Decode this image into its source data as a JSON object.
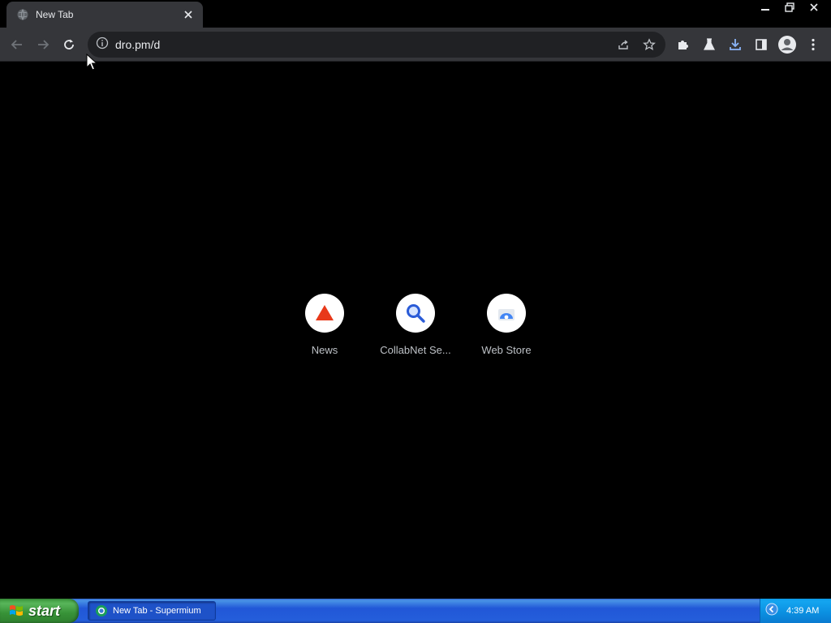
{
  "browser": {
    "tab": {
      "title": "New Tab"
    },
    "address": {
      "url": "dro.pm/d"
    }
  },
  "ntp": {
    "shortcuts": [
      {
        "label": "News",
        "icon": "triangle-icon",
        "color": "#e8391a"
      },
      {
        "label": "CollabNet Se...",
        "icon": "magnifier-icon",
        "color": "#2a5bd7"
      },
      {
        "label": "Web Store",
        "icon": "web-store-icon",
        "color": "#4285f4"
      }
    ]
  },
  "taskbar": {
    "start_label": "start",
    "task_label": "New Tab - Supermium",
    "clock": "4:39 AM"
  },
  "colors": {
    "accent_download": "#8ab4f8",
    "toolbar": "#35363a",
    "omnibox": "#202124"
  }
}
